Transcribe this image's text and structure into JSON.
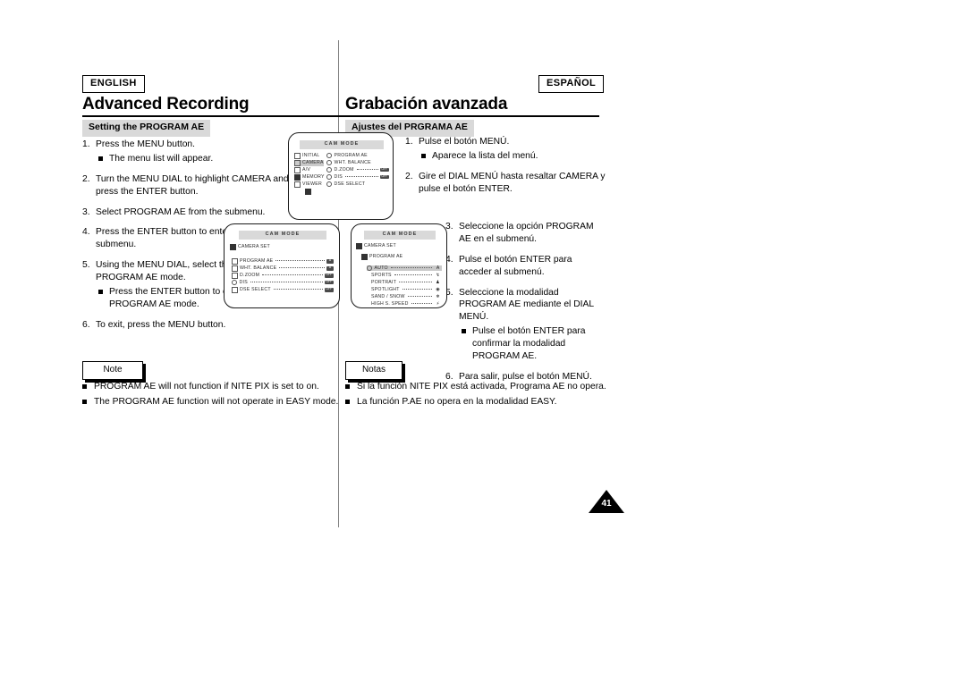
{
  "page": {
    "number": "41"
  },
  "english": {
    "badge": "ENGLISH",
    "title": "Advanced Recording",
    "section": "Setting the PROGRAM AE",
    "steps": [
      {
        "num": "1.",
        "text": "Press the MENU button.",
        "sub": "The menu list will appear."
      },
      {
        "num": "2.",
        "text": "Turn the MENU DIAL to highlight CAMERA and press the ENTER button."
      },
      {
        "num": "3.",
        "text": "Select PROGRAM AE from the submenu."
      },
      {
        "num": "4.",
        "text": "Press the ENTER button to enter the submenu."
      },
      {
        "num": "5.",
        "text": "Using the MENU DIAL, select the PROGRAM AE mode.",
        "sub": "Press the ENTER button to confirm the PROGRAM AE mode."
      },
      {
        "num": "6.",
        "text": "To exit, press the MENU button."
      }
    ],
    "note_label": "Note",
    "notes": [
      "PROGRAM AE will not function if NITE PIX is set to on.",
      "The PROGRAM AE function will not operate in EASY mode."
    ]
  },
  "spanish": {
    "badge": "ESPAÑOL",
    "title": "Grabación avanzada",
    "section": "Ajustes del PRGRAMA AE",
    "steps_top": [
      {
        "num": "1.",
        "text": "Pulse el botón MENÚ.",
        "sub": "Aparece la lista del menú."
      },
      {
        "num": "2.",
        "text": "Gire el DIAL MENÚ hasta resaltar CAMERA y pulse el botón ENTER."
      }
    ],
    "steps_bottom": [
      {
        "num": "3.",
        "text": "Seleccione la opción PROGRAM AE en el submenú."
      },
      {
        "num": "4.",
        "text": "Pulse el botón ENTER para acceder al submenú."
      },
      {
        "num": "5.",
        "text": "Seleccione la modalidad PROGRAM AE mediante el DIAL MENÚ.",
        "sub": "Pulse el botón ENTER para confirmar la modalidad PROGRAM AE."
      },
      {
        "num": "6.",
        "text": "Para salir, pulse el botón MENÚ."
      }
    ],
    "note_label": "Notas",
    "notes": [
      "Si la función NITE PIX está activada, Programa AE no opera.",
      "La función P.AE no opera en la modalidad EASY."
    ]
  },
  "lcd_main_menu": {
    "title": "CAM MODE",
    "left_column": [
      {
        "label": "INITIAL",
        "selected": false
      },
      {
        "label": "CAMERA",
        "selected": true
      },
      {
        "label": "A/V",
        "selected": false
      },
      {
        "label": "MEMORY",
        "selected": false
      },
      {
        "label": "VIEWER",
        "selected": false
      }
    ],
    "right_column": [
      {
        "label": "PROGRAM AE",
        "value": ""
      },
      {
        "label": "WHT. BALANCE",
        "value": ""
      },
      {
        "label": "D.ZOOM",
        "value": "OFF"
      },
      {
        "label": "DIS",
        "value": "OFF"
      },
      {
        "label": "DSE SELECT",
        "value": ""
      }
    ]
  },
  "lcd_camera_set": {
    "title": "CAM MODE",
    "header": "CAMERA SET",
    "items": [
      {
        "label": "PROGRAM AE",
        "value": "A"
      },
      {
        "label": "WHT. BALANCE",
        "value": "A"
      },
      {
        "label": "D.ZOOM",
        "value": "OFF"
      },
      {
        "label": "DIS",
        "value": "OFF"
      },
      {
        "label": "DSE SELECT",
        "value": "OFF"
      }
    ]
  },
  "lcd_program_ae": {
    "title": "CAM MODE",
    "header": "CAMERA SET",
    "subheader": "PROGRAM AE",
    "items": [
      {
        "label": "AUTO",
        "selected": true,
        "glyph": "A"
      },
      {
        "label": "SPORTS",
        "selected": false,
        "glyph": "↯"
      },
      {
        "label": "PORTRAIT",
        "selected": false,
        "glyph": "♟"
      },
      {
        "label": "SPOTLIGHT",
        "selected": false,
        "glyph": "◉"
      },
      {
        "label": "SAND / SNOW",
        "selected": false,
        "glyph": "❄"
      },
      {
        "label": "HIGH S. SPEED",
        "selected": false,
        "glyph": "⚡"
      }
    ]
  }
}
